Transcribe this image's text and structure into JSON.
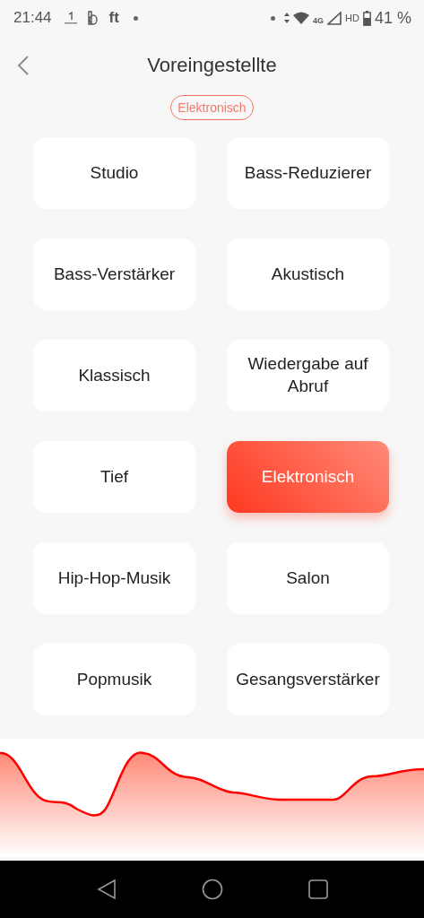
{
  "status_bar": {
    "time": "21:44",
    "notification": "ft",
    "network": "4G",
    "hd": "HD",
    "battery": "41 %"
  },
  "header": {
    "title": "Voreingestellte"
  },
  "current_preset": "Elektronisch",
  "preset_rows": [
    [
      {
        "label": "Studio",
        "selected": false
      },
      {
        "label": "Bass-Reduzierer",
        "selected": false
      }
    ],
    [
      {
        "label": "Bass-Verstärker",
        "selected": false
      },
      {
        "label": "Akustisch",
        "selected": false
      }
    ],
    [
      {
        "label": "Klassisch",
        "selected": false
      },
      {
        "label": "Wiedergabe auf Abruf",
        "selected": false
      }
    ],
    [
      {
        "label": "Tief",
        "selected": false
      },
      {
        "label": "Elektronisch",
        "selected": true
      }
    ],
    [
      {
        "label": "Hip-Hop-Musik",
        "selected": false
      },
      {
        "label": "Salon",
        "selected": false
      }
    ],
    [
      {
        "label": "Popmusik",
        "selected": false
      },
      {
        "label": "Gesangsverstärker",
        "selected": false
      }
    ]
  ]
}
